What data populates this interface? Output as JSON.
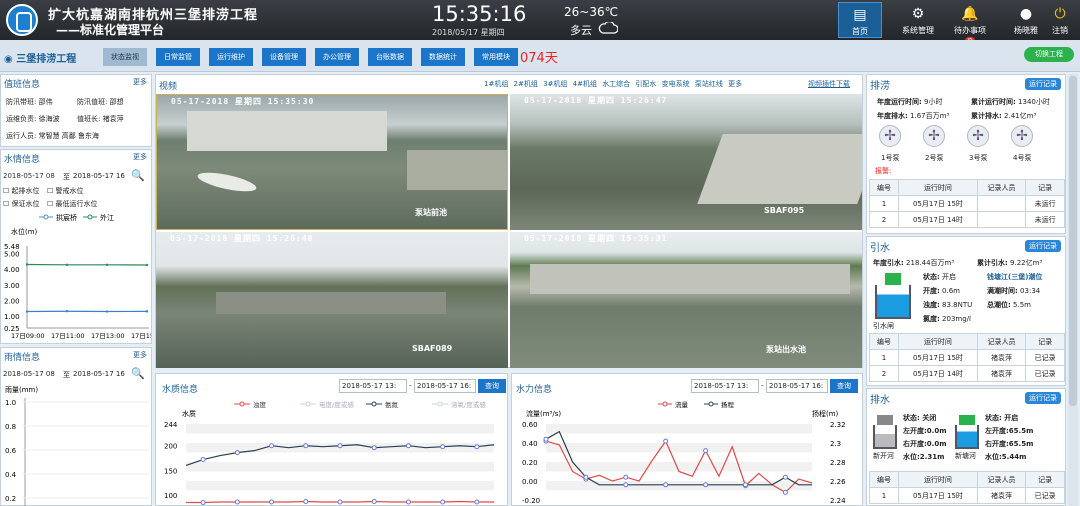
{
  "header": {
    "title": "扩大杭嘉湖南排杭州三堡排涝工程",
    "subtitle": "——标准化管理平台",
    "clock": "15:35:16",
    "date": "2018/05/17  星期四",
    "temperature": "26~36℃",
    "weather": "多云",
    "nav": [
      {
        "label": "首页",
        "icon": "document-icon"
      },
      {
        "label": "系统管理",
        "icon": "gear-icon"
      },
      {
        "label": "待办事项",
        "badge": "0",
        "icon": "bell-icon"
      },
      {
        "label": "杨晓雅",
        "icon": "user-icon"
      },
      {
        "label": "注销",
        "icon": "power-icon"
      }
    ]
  },
  "menu": {
    "project": "三堡排涝工程",
    "items": [
      "状态监视",
      "日常监管",
      "运行维护",
      "设备管理",
      "办公管理",
      "台账数据",
      "数据统计",
      "常用模块"
    ],
    "days": "074天",
    "switch": "切换工程"
  },
  "duty": {
    "title": "值班信息",
    "more": "更多",
    "rows": [
      [
        "防汛带班: 邵伟",
        "防汛值班: 邵想"
      ],
      [
        "运维负责: 徐海波",
        "值班长: 褚袁萍"
      ],
      [
        "运行人员: 常智慧 高鄱 鲁东海"
      ]
    ]
  },
  "water": {
    "title": "水情信息",
    "more": "更多",
    "from": "2018-05-17 08",
    "to_label": "至",
    "to": "2018-05-17 16",
    "checks": [
      "起排水位",
      "警戒水位",
      "保证水位",
      "最低运行水位"
    ],
    "legend": [
      "拱宸桥",
      "外江"
    ],
    "ylabel": "水位(m)",
    "yticks": [
      "5.48",
      "5.00",
      "4.00",
      "3.00",
      "2.00",
      "1.00",
      "0.25"
    ],
    "xticks": [
      "17日09:00",
      "17日11:00",
      "17日13:00",
      "17日15:00"
    ]
  },
  "rain": {
    "title": "雨情信息",
    "more": "更多",
    "from": "2018-05-17 08",
    "to_label": "至",
    "to": "2018-05-17 16",
    "ylabel": "雨量(mm)",
    "yticks": [
      "1.0",
      "0.8",
      "0.6",
      "0.4",
      "0.2"
    ]
  },
  "video": {
    "title": "视频",
    "tabs": [
      "1#机组",
      "2#机组",
      "3#机组",
      "4#机组",
      "水工综合",
      "引配水",
      "变电系统",
      "泵站红线",
      "更多"
    ],
    "link": "视频插件下载",
    "feeds": [
      {
        "ts": "05-17-2018  星期四  15:35:30",
        "tag": "泵站前池"
      },
      {
        "ts": "05-17-2018  星期四  15:26:47",
        "tag": "SBAF095"
      },
      {
        "ts": "05-17-2018  星期四  15:26:48",
        "tag": "SBAF089"
      },
      {
        "ts": "05-17-2018  星期四  15:35:31",
        "tag": "泵站出水池"
      }
    ]
  },
  "quality": {
    "title": "水质信息",
    "from": "2018-05-17 13:",
    "to": "2018-05-17 16:",
    "query": "查询",
    "legend": [
      "浊度",
      "电度/度或感",
      "氨氮",
      "溶氧/度或感"
    ],
    "ylabel": "水质",
    "yticks": [
      "244",
      "200",
      "150",
      "100"
    ]
  },
  "hydro": {
    "title": "水力信息",
    "from": "2018-05-17 13:",
    "to": "2018-05-17 16:",
    "query": "查询",
    "legend": [
      "流量",
      "扬程"
    ],
    "ylabel": "流量(m³/s)",
    "y2label": "扬程(m)",
    "yticks": [
      "0.60",
      "0.40",
      "0.20",
      "0.00",
      "-0.20"
    ],
    "y2ticks": [
      "2.32",
      "2.3",
      "2.28",
      "2.26",
      "2.24"
    ]
  },
  "drain": {
    "title": "排涝",
    "record": "运行记录",
    "stats": [
      [
        "年度运行时间:",
        "9小时",
        "累计运行时间:",
        "1340小时"
      ],
      [
        "年度排水:",
        "1.67百万m³",
        "累计排水:",
        "2.41亿m³"
      ]
    ],
    "pumps": [
      "1号泵",
      "2号泵",
      "3号泵",
      "4号泵"
    ],
    "alarm": "报警:",
    "headers": [
      "编号",
      "运行时间",
      "记录人员",
      "记录"
    ],
    "rows": [
      [
        "1",
        "05月17日 15时",
        "",
        "未运行"
      ],
      [
        "2",
        "05月17日 14时",
        "",
        "未运行"
      ]
    ]
  },
  "intake": {
    "title": "引水",
    "record": "运行记录",
    "annual_label": "年度引水:",
    "annual": "218.44百万m³",
    "total_label": "累计引水:",
    "total": "9.22亿m³",
    "status_label": "状态:",
    "status": "开启",
    "river": "钱塘江(三堡)潮位",
    "open_label": "开度:",
    "open": "0.6m",
    "turb_label": "浊度:",
    "turb": "83.8NTU",
    "chlor_label": "氯度:",
    "chlor": "203mg/l",
    "fill_label": "满潮时间:",
    "fill": "03:34",
    "level_label": "总潮位:",
    "level": "5.5m",
    "gate": "引水闸",
    "headers": [
      "编号",
      "运行时间",
      "记录人员",
      "记录"
    ],
    "rows": [
      [
        "1",
        "05月17日 15时",
        "褚袁萍",
        "已记录"
      ],
      [
        "2",
        "05月17日 14时",
        "褚袁萍",
        "已记录"
      ]
    ]
  },
  "outlet": {
    "title": "排水",
    "record": "运行记录",
    "g1": {
      "name": "新开河",
      "status": "状态: 关闭",
      "left": "左开度:0.0m",
      "right": "右开度:0.0m",
      "level": "水位:2.31m"
    },
    "g2": {
      "name": "新塘河",
      "status": "状态: 开启",
      "left": "左开度:65.5m",
      "right": "右开度:65.5m",
      "level": "水位:5.44m"
    },
    "headers": [
      "编号",
      "运行时间",
      "记录人员",
      "记录"
    ],
    "rows": [
      [
        "1",
        "05月17日 15时",
        "褚袁萍",
        "已记录"
      ]
    ]
  },
  "chart_data": [
    {
      "type": "line",
      "title": "水情信息",
      "ylabel": "水位(m)",
      "ylim": [
        0.25,
        5.48
      ],
      "x": [
        "17日09:00",
        "17日11:00",
        "17日13:00",
        "17日15:00"
      ],
      "series": [
        {
          "name": "拱宸桥",
          "values": [
            4.3,
            4.28,
            4.28,
            4.27
          ]
        },
        {
          "name": "外江",
          "values": [
            1.3,
            1.32,
            1.3,
            1.31
          ]
        }
      ]
    },
    {
      "type": "line",
      "title": "水质信息",
      "ylabel": "水质",
      "ylim": [
        90,
        244
      ],
      "series": [
        {
          "name": "氨氮",
          "values": [
            160,
            172,
            180,
            186,
            190,
            200,
            196,
            200,
            198,
            200,
            202,
            196,
            198,
            200,
            196,
            198,
            200,
            198,
            202
          ]
        },
        {
          "name": "浊度",
          "values": [
            85,
            85,
            86,
            86,
            86,
            86,
            86,
            87,
            86,
            86,
            86,
            87,
            86,
            86,
            86,
            86,
            87,
            86,
            86
          ]
        }
      ]
    },
    {
      "type": "line",
      "title": "水力信息",
      "ylabel": "流量(m³/s)",
      "ylim": [
        -0.2,
        0.6
      ],
      "series": [
        {
          "name": "流量",
          "values": [
            0.42,
            0.38,
            0.1,
            0.02,
            0.06,
            0.0,
            0.04,
            0.0,
            0.22,
            0.42,
            0.1,
            0.05,
            0.32,
            0.05,
            0.36,
            -0.05,
            0.08,
            -0.04,
            -0.12,
            0.02,
            -0.02
          ]
        },
        {
          "name": "扬程",
          "values": [
            2.3,
            2.31,
            2.27,
            2.25,
            2.24,
            2.24,
            2.24,
            2.24,
            2.24,
            2.24,
            2.24,
            2.24,
            2.24,
            2.24,
            2.24,
            2.24,
            2.24,
            2.24,
            2.25,
            2.24,
            2.24
          ]
        }
      ]
    }
  ]
}
